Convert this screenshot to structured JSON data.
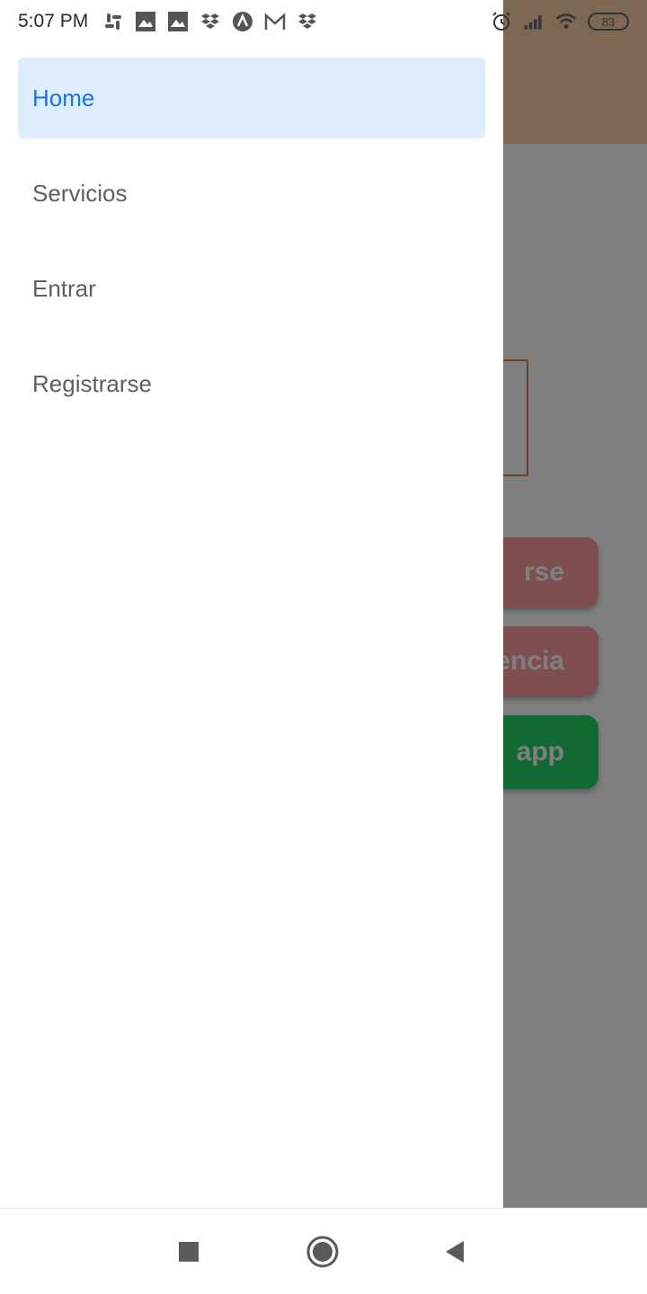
{
  "status_bar": {
    "time": "5:07 PM",
    "left_icons": [
      "slack-icon",
      "photo-icon",
      "photo-icon",
      "dropbox-icon",
      "arc-icon",
      "gmail-icon",
      "dropbox-icon"
    ],
    "right_icons": [
      "alarm-icon",
      "signal-icon",
      "wifi-icon"
    ],
    "battery": "83"
  },
  "drawer": {
    "items": [
      {
        "label": "Home",
        "active": true
      },
      {
        "label": "Servicios",
        "active": false
      },
      {
        "label": "Entrar",
        "active": false
      },
      {
        "label": "Registrarse",
        "active": false
      }
    ]
  },
  "background_app": {
    "buttons": [
      {
        "label": "rse",
        "color": "#ff9c9c"
      },
      {
        "label": "encia",
        "color": "#ff9c9c"
      },
      {
        "label": "app",
        "color": "#25d366"
      }
    ],
    "header_color": "#fbd0a8"
  },
  "colors": {
    "active_item_bg": "#deedff",
    "active_item_text": "#1a73e8",
    "inactive_item_text": "#5f5f5f",
    "scrim": "rgba(0,0,0,0.5)"
  },
  "nav_bar": {
    "buttons": [
      "recents-icon",
      "home-icon",
      "back-icon"
    ]
  }
}
